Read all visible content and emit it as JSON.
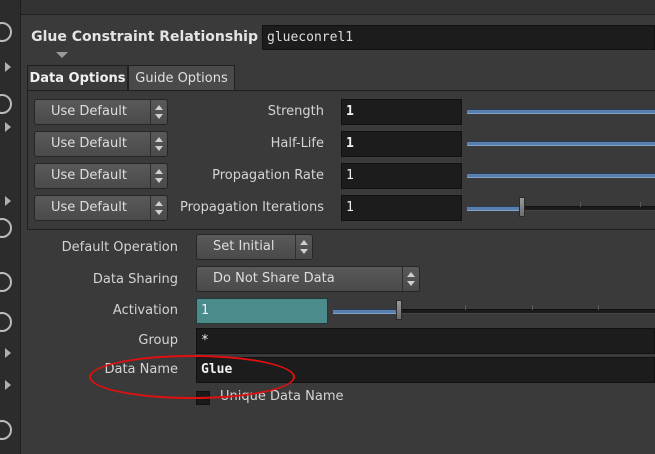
{
  "header": {
    "label": "Glue Constraint Relationship",
    "value": "glueconrel1"
  },
  "tabs": [
    {
      "label": "Data Options",
      "active": true
    },
    {
      "label": "Guide Options",
      "active": false
    }
  ],
  "data_options": {
    "rows": [
      {
        "mode": "Use Default",
        "label": "Strength",
        "value": "1",
        "bold": true
      },
      {
        "mode": "Use Default",
        "label": "Half-Life",
        "value": "1",
        "bold": true
      },
      {
        "mode": "Use Default",
        "label": "Propagation Rate",
        "value": "1",
        "bold": false
      },
      {
        "mode": "Use Default",
        "label": "Propagation Iterations",
        "value": "1",
        "bold": false
      }
    ]
  },
  "params": {
    "default_operation": {
      "label": "Default Operation",
      "value": "Set Initial"
    },
    "data_sharing": {
      "label": "Data Sharing",
      "value": "Do Not Share Data"
    },
    "activation": {
      "label": "Activation",
      "value": "1"
    },
    "group": {
      "label": "Group",
      "value": "*"
    },
    "data_name": {
      "label": "Data Name",
      "value": "Glue"
    },
    "unique_data_name": {
      "label": "Unique Data Name",
      "checked": false
    }
  },
  "colors": {
    "annotation": "#e01010",
    "activation_field": "#4b8b8b",
    "slider_fill": "#5a7fae"
  }
}
